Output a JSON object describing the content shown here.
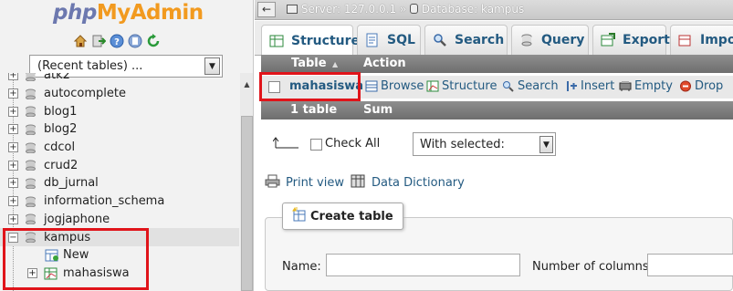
{
  "logo": {
    "part1": "php",
    "part2": "MyAdmin"
  },
  "nav_icons": [
    "home-icon",
    "exit-icon",
    "help-icon",
    "docs-icon",
    "reload-icon"
  ],
  "recent_tables": {
    "selected": "(Recent tables) ..."
  },
  "databases": [
    {
      "name": "atk2"
    },
    {
      "name": "autocomplete"
    },
    {
      "name": "blog1"
    },
    {
      "name": "blog2"
    },
    {
      "name": "cdcol"
    },
    {
      "name": "crud2"
    },
    {
      "name": "db_jurnal"
    },
    {
      "name": "information_schema"
    },
    {
      "name": "jogjaphone"
    },
    {
      "name": "kampus"
    }
  ],
  "kampus_children": [
    {
      "label": "New"
    },
    {
      "label": "mahasiswa"
    }
  ],
  "breadcrumb": {
    "back": "←",
    "server": "Server: 127.0.0.1",
    "sep": "»",
    "database": "Database: kampus"
  },
  "tabs": [
    {
      "label": "Structure",
      "icon": "structure-icon"
    },
    {
      "label": "SQL",
      "icon": "sql-icon"
    },
    {
      "label": "Search",
      "icon": "search-icon"
    },
    {
      "label": "Query",
      "icon": "query-icon"
    },
    {
      "label": "Export",
      "icon": "export-icon"
    },
    {
      "label": "Impo",
      "icon": "import-icon"
    }
  ],
  "table": {
    "headers": {
      "table": "Table",
      "sort": "▲",
      "action": "Action"
    },
    "rows": [
      {
        "name": "mahasiswa",
        "actions": [
          "Browse",
          "Structure",
          "Search",
          "Insert",
          "Empty",
          "Drop"
        ]
      }
    ],
    "footer": {
      "count": "1 table",
      "sum": "Sum"
    }
  },
  "bulk": {
    "check_all": "Check All",
    "with_selected": "With selected:"
  },
  "links": {
    "print_view": "Print view",
    "data_dictionary": "Data Dictionary"
  },
  "create_table": {
    "legend": "Create table",
    "name_label": "Name:",
    "columns_label": "Number of columns:"
  },
  "colors": {
    "link": "#235a81",
    "highlight": "#e0141a",
    "header_bg": "#7e7e7e"
  }
}
